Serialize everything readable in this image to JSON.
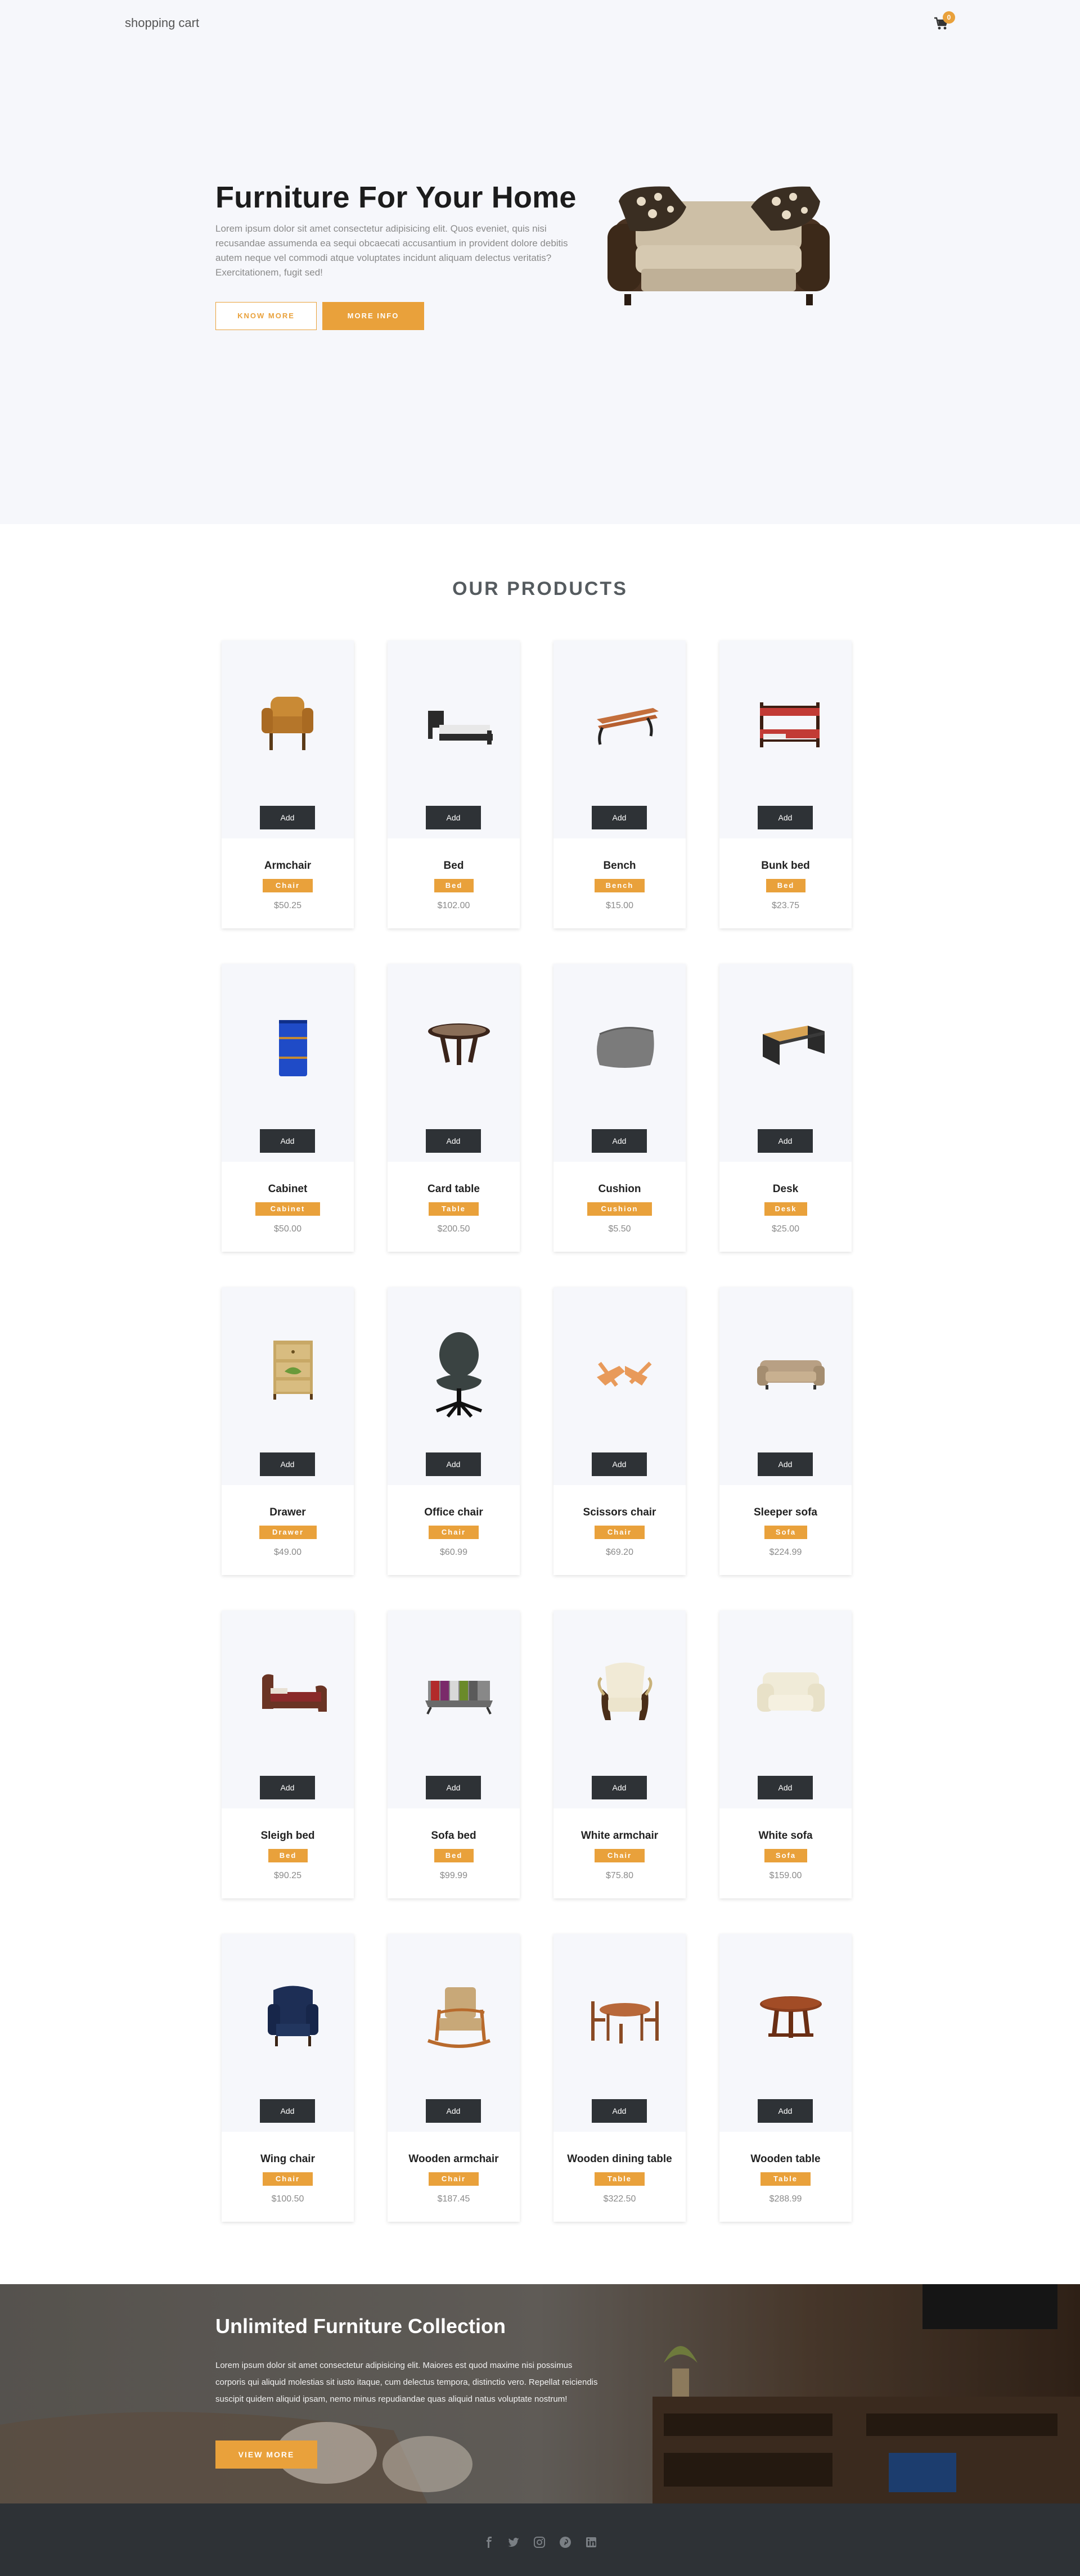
{
  "nav": {
    "brand": "shopping cart",
    "cart_count": "0",
    "cart_icon": "cart-icon"
  },
  "hero": {
    "title": "Furniture For Your Home",
    "text": "Lorem ipsum dolor sit amet consectetur adipisicing elit. Quos eveniet, quis nisi recusandae assumenda ea sequi obcaecati accusantium in provident dolore debitis autem neque vel commodi atque voluptates incidunt aliquam delectus veritatis? Exercitationem, fugit sed!",
    "btn_know_more": "KNOW MORE",
    "btn_more_info": "MORE INFO"
  },
  "products": {
    "title": "OUR PRODUCTS",
    "add_label": "Add",
    "items": [
      {
        "name": "Armchair",
        "category": "Chair",
        "price": "$50.25",
        "icon": "armchair-icon"
      },
      {
        "name": "Bed",
        "category": "Bed",
        "price": "$102.00",
        "icon": "bed-icon"
      },
      {
        "name": "Bench",
        "category": "Bench",
        "price": "$15.00",
        "icon": "bench-icon"
      },
      {
        "name": "Bunk bed",
        "category": "Bed",
        "price": "$23.75",
        "icon": "bunk-bed-icon"
      },
      {
        "name": "Cabinet",
        "category": "Cabinet",
        "price": "$50.00",
        "icon": "cabinet-icon"
      },
      {
        "name": "Card table",
        "category": "Table",
        "price": "$200.50",
        "icon": "card-table-icon"
      },
      {
        "name": "Cushion",
        "category": "Cushion",
        "price": "$5.50",
        "icon": "cushion-icon"
      },
      {
        "name": "Desk",
        "category": "Desk",
        "price": "$25.00",
        "icon": "desk-icon"
      },
      {
        "name": "Drawer",
        "category": "Drawer",
        "price": "$49.00",
        "icon": "drawer-icon"
      },
      {
        "name": "Office chair",
        "category": "Chair",
        "price": "$60.99",
        "icon": "office-chair-icon"
      },
      {
        "name": "Scissors chair",
        "category": "Chair",
        "price": "$69.20",
        "icon": "scissors-chair-icon"
      },
      {
        "name": "Sleeper sofa",
        "category": "Sofa",
        "price": "$224.99",
        "icon": "sleeper-sofa-icon"
      },
      {
        "name": "Sleigh bed",
        "category": "Bed",
        "price": "$90.25",
        "icon": "sleigh-bed-icon"
      },
      {
        "name": "Sofa bed",
        "category": "Bed",
        "price": "$99.99",
        "icon": "sofa-bed-icon"
      },
      {
        "name": "White armchair",
        "category": "Chair",
        "price": "$75.80",
        "icon": "white-armchair-icon"
      },
      {
        "name": "White sofa",
        "category": "Sofa",
        "price": "$159.00",
        "icon": "white-sofa-icon"
      },
      {
        "name": "Wing chair",
        "category": "Chair",
        "price": "$100.50",
        "icon": "wing-chair-icon"
      },
      {
        "name": "Wooden armchair",
        "category": "Chair",
        "price": "$187.45",
        "icon": "wooden-armchair-icon"
      },
      {
        "name": "Wooden dining table",
        "category": "Table",
        "price": "$322.50",
        "icon": "dining-table-icon"
      },
      {
        "name": "Wooden table",
        "category": "Table",
        "price": "$288.99",
        "icon": "wooden-table-icon"
      }
    ]
  },
  "banner": {
    "title": "Unlimited Furniture Collection",
    "text": "Lorem ipsum dolor sit amet consectetur adipisicing elit. Maiores est quod maxime nisi possimus corporis qui aliquid molestias sit iusto itaque, cum delectus tempora, distinctio vero. Repellat reiciendis suscipit quidem aliquid ipsam, nemo minus repudiandae quas aliquid natus voluptate nostrum!",
    "btn": "VIEW MORE"
  },
  "footer": {
    "social": [
      "facebook-icon",
      "twitter-icon",
      "instagram-icon",
      "pinterest-icon",
      "linkedin-icon"
    ]
  },
  "colors": {
    "accent": "#e9a13b",
    "dark": "#2e3236",
    "hero_bg": "#f6f7fb"
  }
}
